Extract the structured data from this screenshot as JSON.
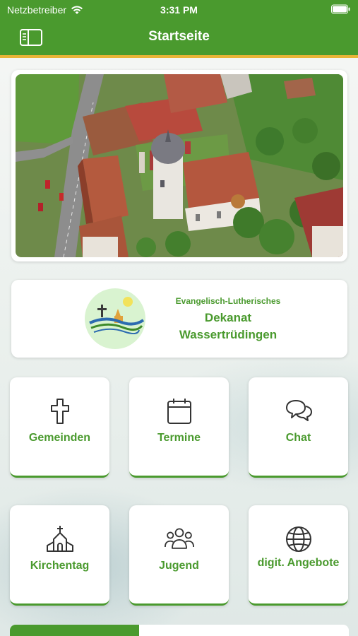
{
  "status_bar": {
    "carrier": "Netzbetreiber",
    "time": "3:31 PM"
  },
  "nav": {
    "title": "Startseite"
  },
  "dekanat": {
    "line1": "Evangelisch-Lutherisches",
    "line2": "Dekanat",
    "line3": "Wassertrüdingen"
  },
  "tiles": [
    {
      "label": "Gemeinden",
      "icon": "cross-icon"
    },
    {
      "label": "Termine",
      "icon": "calendar-icon"
    },
    {
      "label": "Chat",
      "icon": "chat-bubbles-icon"
    },
    {
      "label": "Kirchentag",
      "icon": "church-icon"
    },
    {
      "label": "Jugend",
      "icon": "group-icon"
    },
    {
      "label": "digit. Angebote",
      "icon": "globe-icon"
    }
  ],
  "colors": {
    "brand_green": "#4a9a2e",
    "accent_yellow": "#e9b437"
  }
}
